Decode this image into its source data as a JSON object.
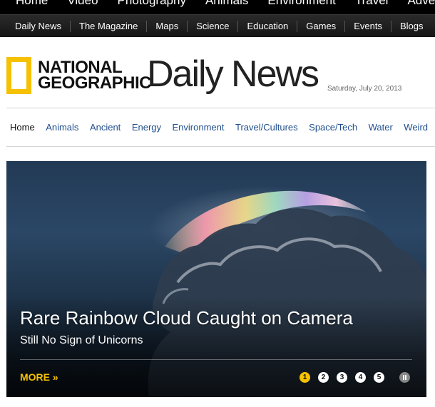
{
  "topnav": {
    "items": [
      "Home",
      "Video",
      "Photography",
      "Animals",
      "Environment",
      "Travel",
      "Adventure"
    ]
  },
  "subnav": {
    "items": [
      "Daily News",
      "The Magazine",
      "Maps",
      "Science",
      "Education",
      "Games",
      "Events",
      "Blogs"
    ]
  },
  "masthead": {
    "logo_line1": "NATIONAL",
    "logo_line2": "GEOGRAPHIC",
    "title": "Daily News",
    "date": "Saturday, July 20, 2013"
  },
  "sections": {
    "items": [
      "Home",
      "Animals",
      "Ancient",
      "Energy",
      "Environment",
      "Travel/Cultures",
      "Space/Tech",
      "Water",
      "Weird"
    ],
    "active": "Home"
  },
  "hero": {
    "headline": "Rare Rainbow Cloud Caught on Camera",
    "subhead": "Still No Sign of Unicorns",
    "more_label": "MORE »",
    "slides": [
      "1",
      "2",
      "3",
      "4",
      "5"
    ],
    "active_slide": "1"
  },
  "colors": {
    "brand_yellow": "#f5c100",
    "link_blue": "#1f4e8c",
    "nav_black": "#000000"
  }
}
